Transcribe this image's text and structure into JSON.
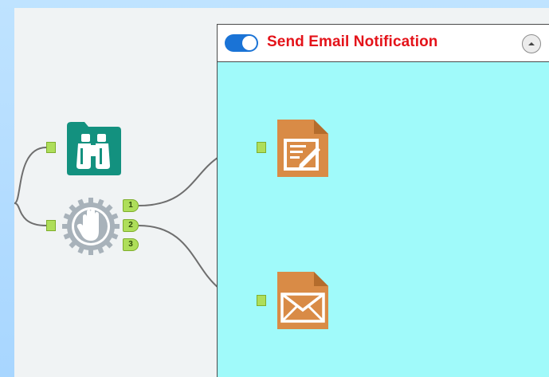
{
  "container": {
    "title": "Send Email Notification",
    "enabled": true
  },
  "tools": {
    "browse": {
      "icon": "binoculars-icon"
    },
    "test": {
      "icon": "stop-hand-icon",
      "outputs": [
        "1",
        "2",
        "3"
      ]
    },
    "report_text": {
      "icon": "document-edit-icon"
    },
    "email": {
      "icon": "envelope-icon"
    }
  },
  "colors": {
    "container_bg": "#a0fafa",
    "title_red": "#e4131a",
    "toggle_blue": "#1a73d6",
    "browse_teal": "#13917f",
    "report_orange": "#d98b46",
    "anchor_green": "#aede5a"
  }
}
